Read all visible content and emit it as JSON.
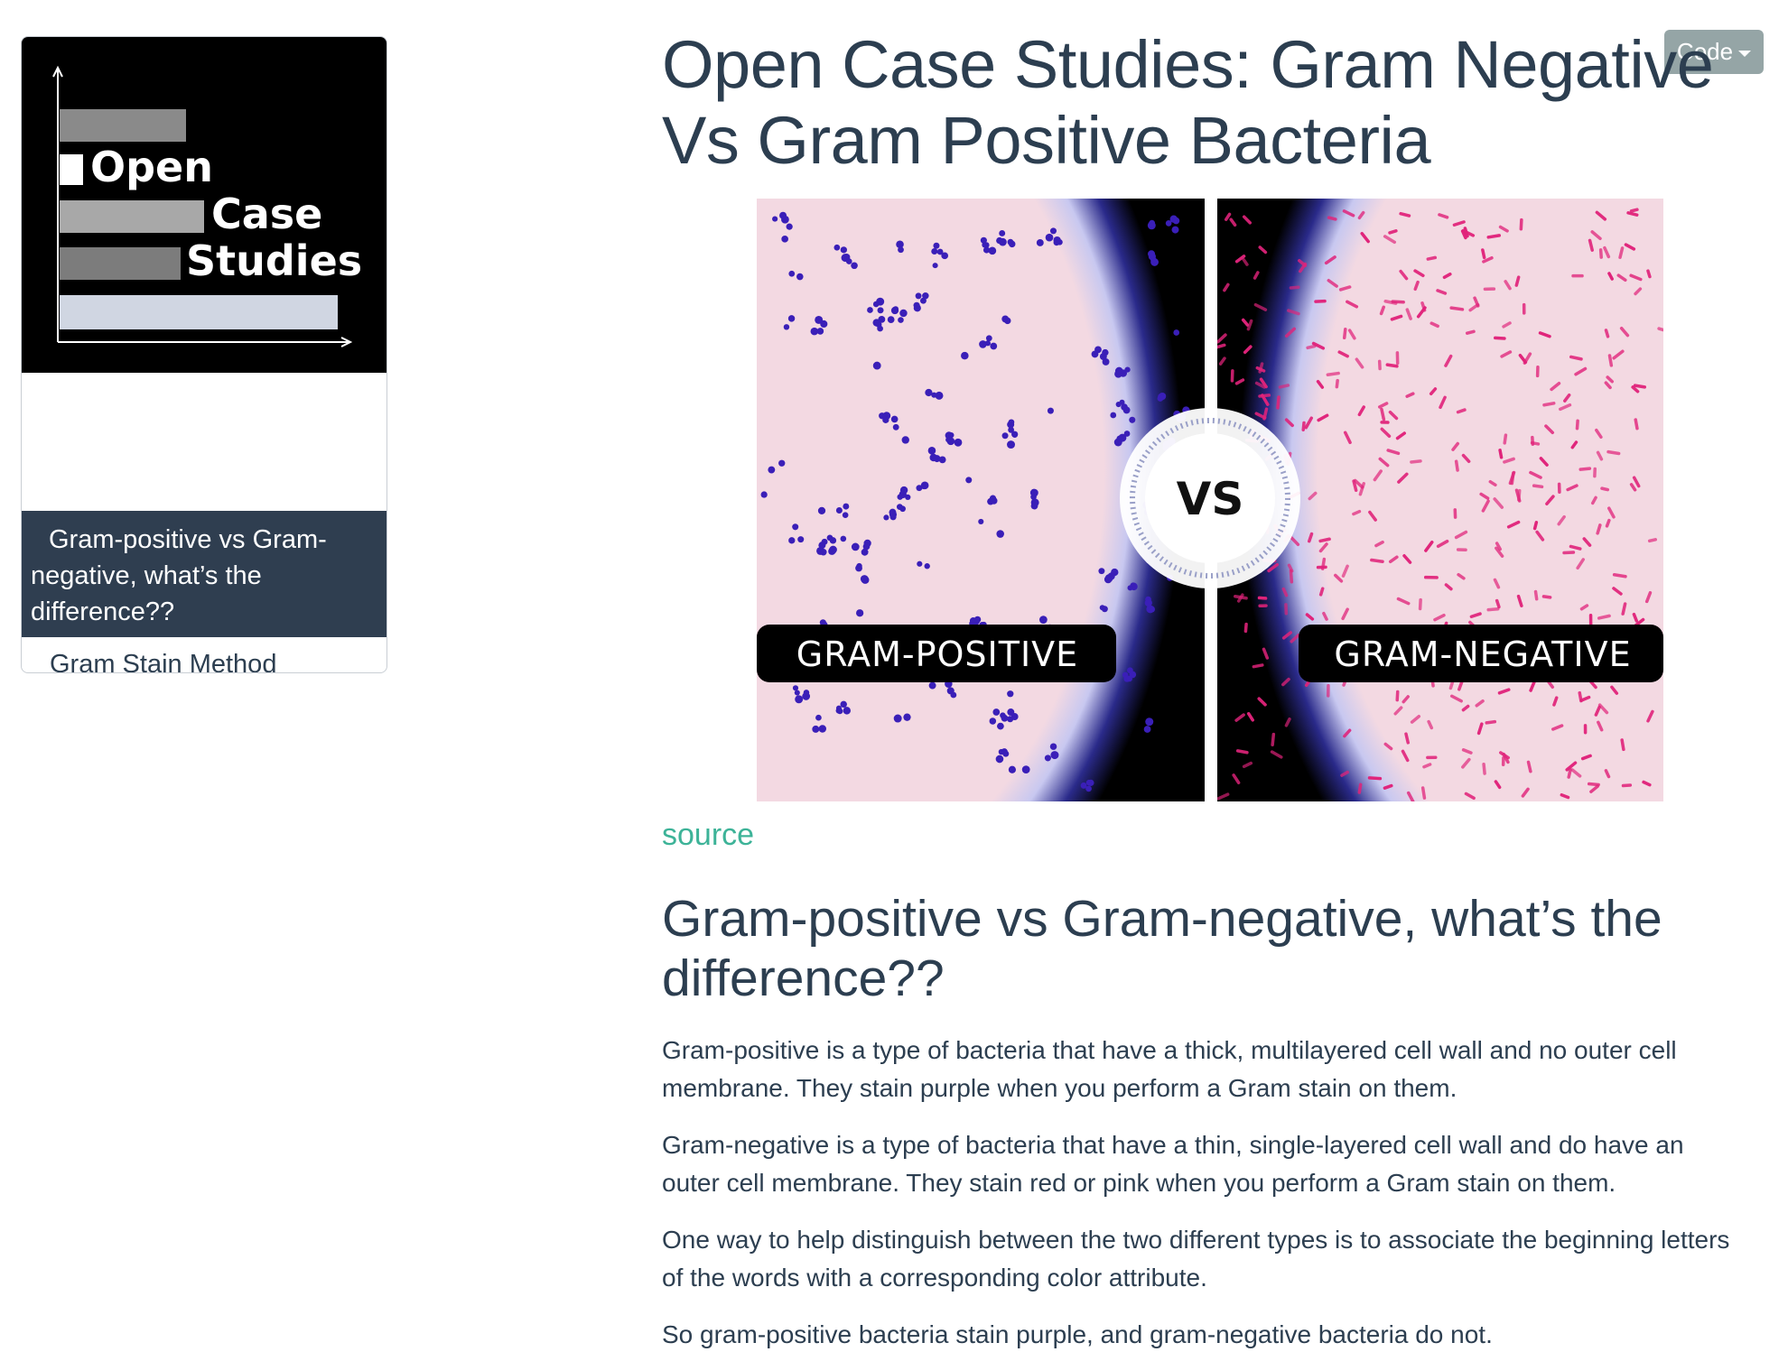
{
  "toc": {
    "logo": {
      "line1": "Open",
      "line2": "Case",
      "line3": "Studies"
    },
    "items": [
      {
        "label": "Gram-positive vs Gram-negative, what’s the difference??",
        "active": true
      },
      {
        "label": "Gram Stain Method",
        "active": false
      }
    ]
  },
  "toolbar": {
    "code_label": "Code"
  },
  "main": {
    "title": "Open Case Studies: Gram Negative Vs Gram Positive Bacteria",
    "hero": {
      "left_label": "GRAM-POSITIVE",
      "right_label": "GRAM-NEGATIVE",
      "vs_label": "VS",
      "colors": {
        "left_bacteria": "#3a1fb8",
        "right_bacteria": "#e0237a",
        "background": "#f3d9e2"
      }
    },
    "source_link": "source",
    "section_heading": "Gram-positive vs Gram-negative, what’s the difference??",
    "paragraphs": [
      "Gram-positive is a type of bacteria that have a thick, multilayered cell wall and no outer cell membrane. They stain purple when you perform a Gram stain on them.",
      "Gram-negative is a type of bacteria that have a thin, single-layered cell wall and do have an outer cell membrane. They stain red or pink when you perform a Gram stain on them.",
      "One way to help distinguish between the two different types is to associate the beginning letters of the words with a corresponding color attribute.",
      "So gram-positive bacteria stain purple, and gram-negative bacteria do not."
    ]
  }
}
